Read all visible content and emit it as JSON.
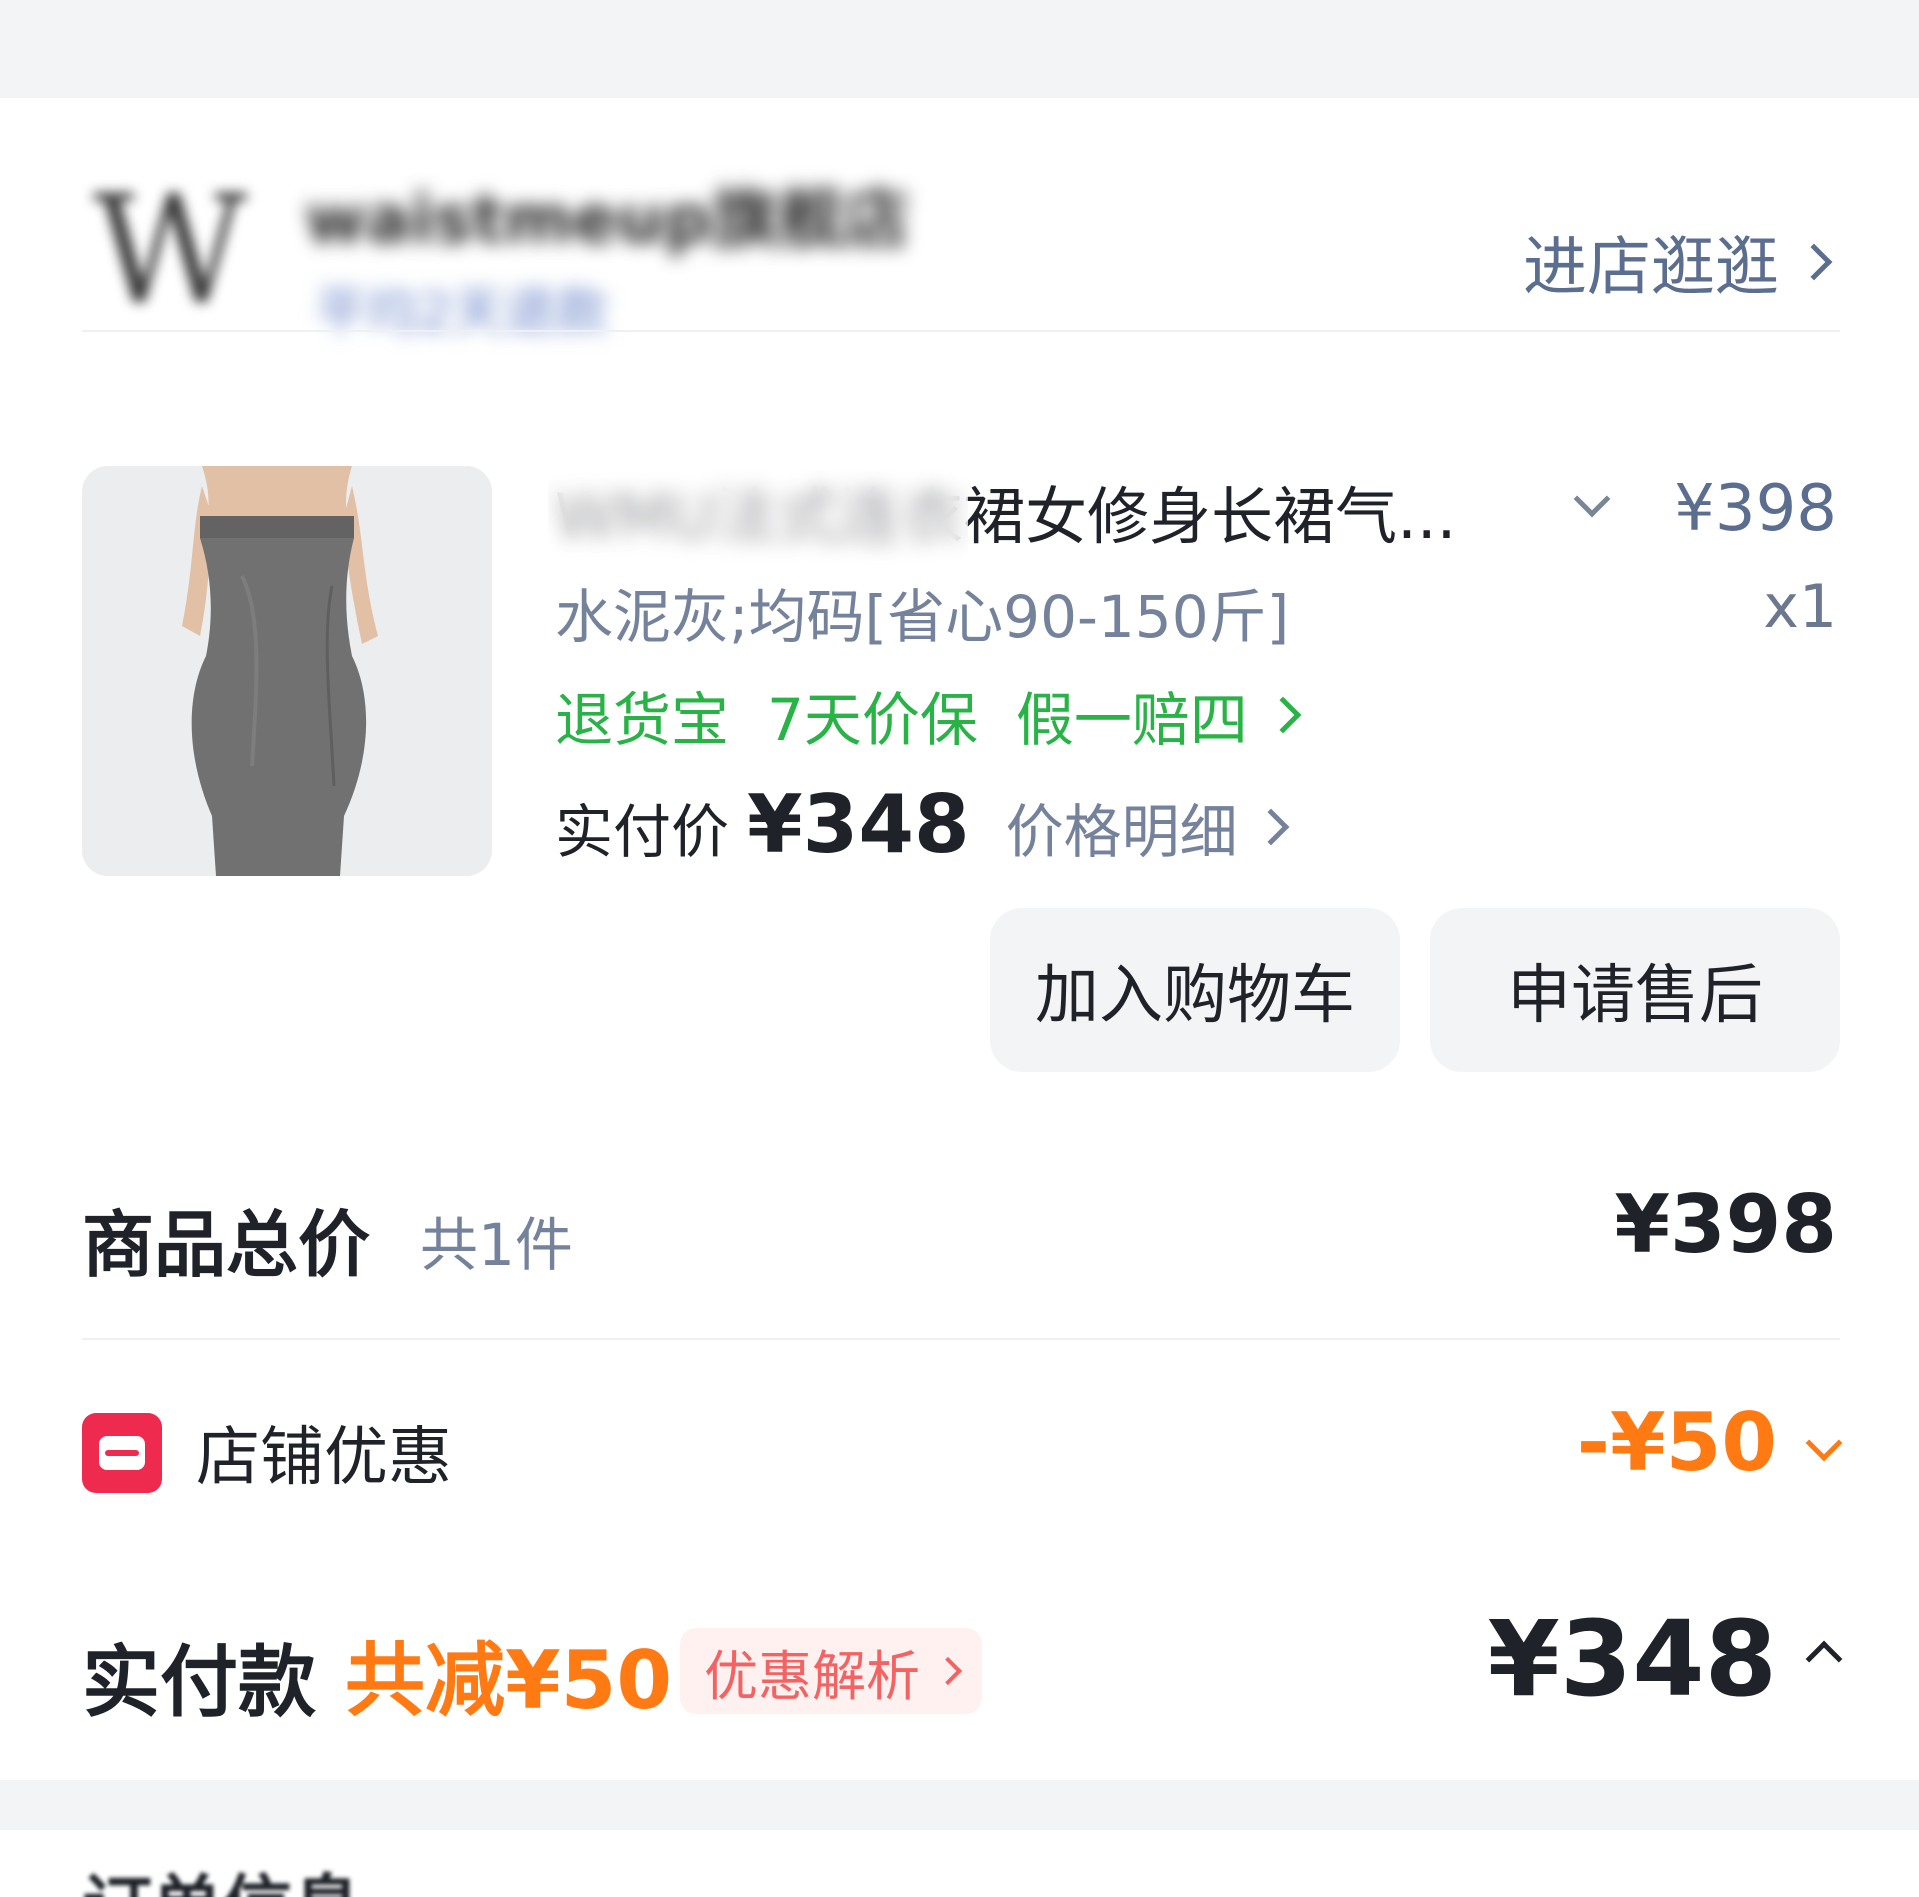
{
  "store": {
    "logo_text": "W",
    "name": "waistmeup旗舰店",
    "subtitle": "平均2天退款",
    "enter_label": "进店逛逛"
  },
  "product": {
    "title": "WMU法式连衣裙女修身长裙气...",
    "unit_price": "¥398",
    "spec": "水泥灰;均码[省心90-150斤]",
    "quantity": "x1",
    "services": [
      "退货宝",
      "7天价保",
      "假一赔四"
    ],
    "paid_label": "实付价",
    "paid_value": "¥348",
    "price_detail_label": "价格明细",
    "colors": {
      "service_green": "#29b347",
      "muted": "#75829b"
    }
  },
  "actions": {
    "add_to_cart": "加入购物车",
    "after_sales": "申请售后"
  },
  "summary": {
    "total_label": "商品总价",
    "total_count": "共1件",
    "total_value": "¥398",
    "discount_label": "店铺优惠",
    "discount_value": "-¥50",
    "discount_icon": "store-coupon-icon",
    "final_label": "实付款",
    "saved_text": "共减¥50",
    "analysis_label": "优惠解析",
    "final_value": "¥348",
    "colors": {
      "accent_orange": "#ff7a12",
      "chip_text": "#f36363",
      "icon_red": "#ee2b4f"
    }
  },
  "next_section": {
    "title": "订单信息"
  }
}
